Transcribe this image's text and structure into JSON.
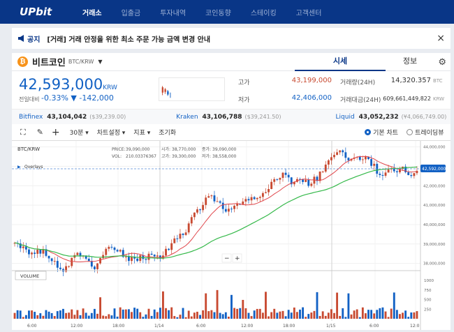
{
  "nav": {
    "logo": "UPbit",
    "items": [
      "거래소",
      "입출금",
      "투자내역",
      "코인동향",
      "스테이킹",
      "고객센터"
    ]
  },
  "notice": {
    "badge": "공지",
    "text": "[거래] 거래 안정을 위한 최소 주문 가능 금액 변경 안내",
    "close": "×"
  },
  "coin": {
    "icon": "₿",
    "name": "비트코인",
    "pair": "BTC/KRW",
    "dropdown": "▼",
    "tab_sise": "시세",
    "tab_info": "정보"
  },
  "price": {
    "current": "42,593,000",
    "unit": "KRW",
    "change_label": "전일대비",
    "change_pct": "-0.33%",
    "change_amt": "▼ -142,000"
  },
  "stats": {
    "high_label": "고가",
    "high": "43,199,000",
    "low_label": "저가",
    "low": "42,406,000",
    "vol_label": "거래량(24H)",
    "vol": "14,320.357",
    "vol_unit": "BTC",
    "amt_label": "거래대금(24H)",
    "amt": "609,661,449,822",
    "amt_unit": "KRW"
  },
  "exchanges": [
    {
      "name": "Bitfinex",
      "price": "43,104,042",
      "sub": "($39,239.00)"
    },
    {
      "name": "Kraken",
      "price": "43,106,788",
      "sub": "($39,241.50)"
    },
    {
      "name": "Liquid",
      "price": "43,052,232",
      "sub": "(¥4,066,749.00)"
    }
  ],
  "toolbar": {
    "interval": "30분",
    "chart_settings": "차트설정",
    "indicators": "지표",
    "lookup": "조기화",
    "basic_chart": "기본 차트",
    "tradingview": "트레이딩뷰"
  },
  "chart_info": {
    "symbol": "BTC/KRW",
    "price_label": "PRICE:",
    "price": "39,090,000",
    "vol_label": "VOL:",
    "vol": "210.03376367",
    "open_label": "시가:",
    "open": "38,770,000",
    "close_label": "종가:",
    "close": "39,090,000",
    "high_label": "고가:",
    "high": "39,300,000",
    "low_label": "저가:",
    "low": "38,558,000",
    "overlays": "Overlays",
    "volume_label": "VOLUME",
    "current_tag": "42,592,000"
  },
  "colors": {
    "brand": "#093687",
    "up": "#c84a31",
    "down": "#1261c4",
    "ma_short": "#e0454a",
    "ma_long": "#35b94a"
  },
  "chart_data": {
    "type": "candlestick",
    "price_ticks": [
      "44,000,000",
      "43,000,000",
      "42,000,000",
      "41,000,000",
      "40,000,000",
      "39,000,000",
      "38,000,000"
    ],
    "volume_ticks": [
      "1000",
      "750",
      "500",
      "250"
    ],
    "x_ticks": [
      "6:00",
      "12:00",
      "18:00",
      "1/14",
      "6:00",
      "12:00",
      "18:00",
      "1/15",
      "6:00",
      "12:0"
    ],
    "ylim": [
      37700000,
      44200000
    ],
    "close_path": [
      39000000,
      38800000,
      38400000,
      38700000,
      38300000,
      37600000,
      37900000,
      38600000,
      38200000,
      37700000,
      38500000,
      38900000,
      38500000,
      38200000,
      38300000,
      38400000,
      38300000,
      38600000,
      39200000,
      39600000,
      40400000,
      41100000,
      41500000,
      41000000,
      40700000,
      41000000,
      41300000,
      41200000,
      41700000,
      42300000,
      42600000,
      42200000,
      42300000,
      42100000,
      42500000,
      43300000,
      43800000,
      43500000,
      43300000,
      43500000,
      43100000,
      42500000,
      42700000,
      42900000,
      42700000,
      42600000
    ]
  }
}
